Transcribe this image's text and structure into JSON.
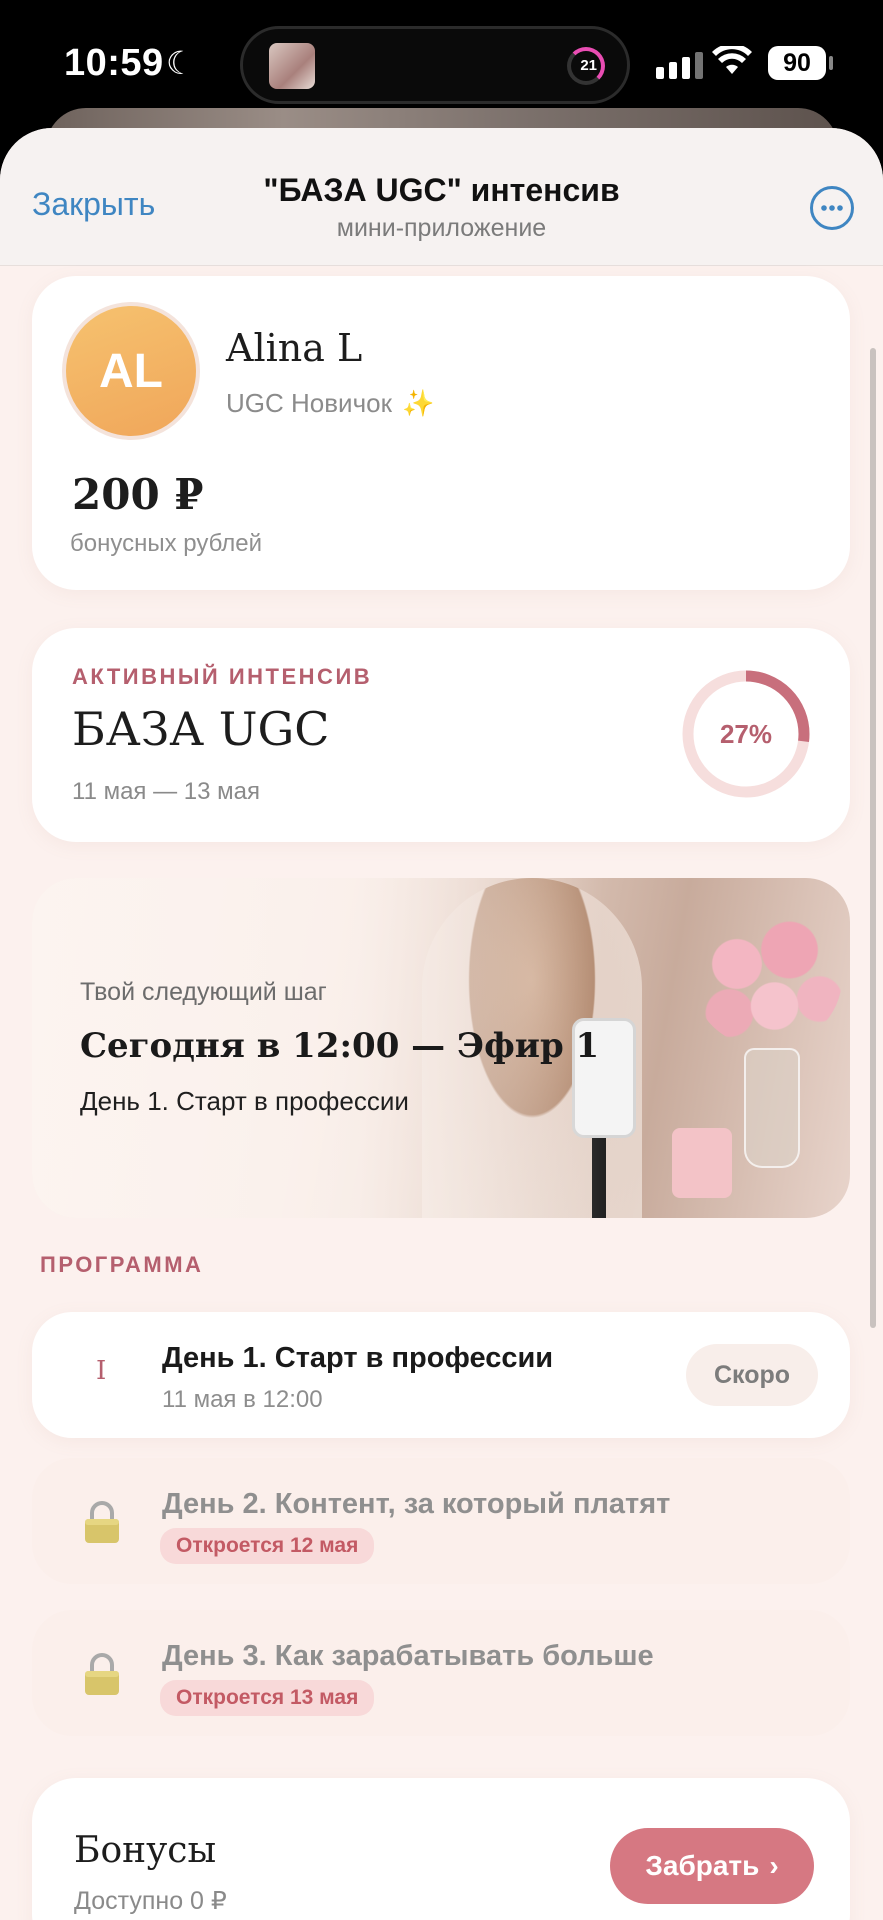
{
  "status_bar": {
    "time": "10:59",
    "moon_icon": "☾",
    "island_count": "21",
    "wifi_icon": "wifi-icon",
    "battery": "90"
  },
  "nav": {
    "close_label": "Закрыть",
    "title": "\"БАЗА UGC\" интенсив",
    "subtitle": "мини-приложение",
    "more_label": "•••"
  },
  "profile": {
    "initials": "AL",
    "name": "Alina L",
    "rank": "UGC Новичок",
    "rank_emoji": "✨",
    "bonus_amount": "200 ₽",
    "bonus_label": "бонусных рублей"
  },
  "intensive": {
    "kicker": "АКТИВНЫЙ ИНТЕНСИВ",
    "title": "БАЗА UGC",
    "dates": "11 мая — 13 мая",
    "progress_percent": 27,
    "progress_label": "27%",
    "accent_color": "#c86f7c",
    "track_color": "#f6dedd"
  },
  "hero": {
    "kicker": "Твой следующий шаг",
    "title": "Сегодня в 12:00 — Эфир 1",
    "subtitle": "День 1. Старт в профессии"
  },
  "program": {
    "section_label": "ПРОГРАММА",
    "lessons": [
      {
        "num": "I",
        "title": "День 1. Старт в профессии",
        "time": "11 мая в 12:00",
        "status": "Скоро"
      },
      {
        "title": "День 2. Контент, за который платят",
        "badge": "Откроется 12 мая"
      },
      {
        "title": "День 3. Как зарабатывать больше",
        "badge": "Откроется 13 мая"
      }
    ]
  },
  "bonuses": {
    "title": "Бонусы",
    "available": "Доступно 0 ₽",
    "button_label": "Забрать",
    "button_chevron": "›"
  }
}
